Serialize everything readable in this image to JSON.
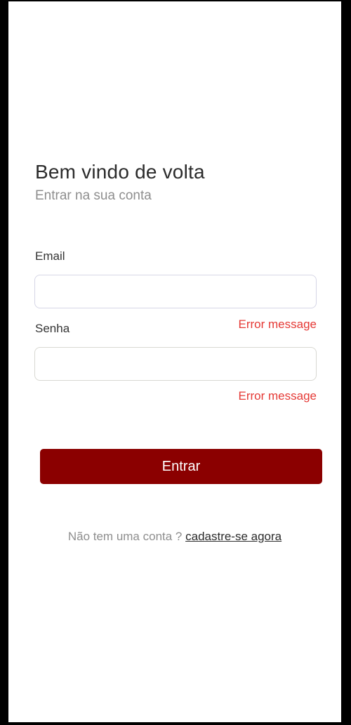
{
  "header": {
    "title": "Bem vindo de volta",
    "subtitle": "Entrar na sua conta"
  },
  "form": {
    "email": {
      "label": "Email",
      "value": "",
      "placeholder": "",
      "error": "Error message"
    },
    "password": {
      "label": "Senha",
      "value": "",
      "placeholder": "",
      "error": "Error message"
    },
    "submit_label": "Entrar"
  },
  "signup": {
    "prompt": "Não tem uma conta ?",
    "link_label": "cadastre-se agora"
  },
  "colors": {
    "primary": "#8b0000",
    "error": "#e53935",
    "text": "#2b2b2b",
    "muted": "#8e8e8e"
  }
}
